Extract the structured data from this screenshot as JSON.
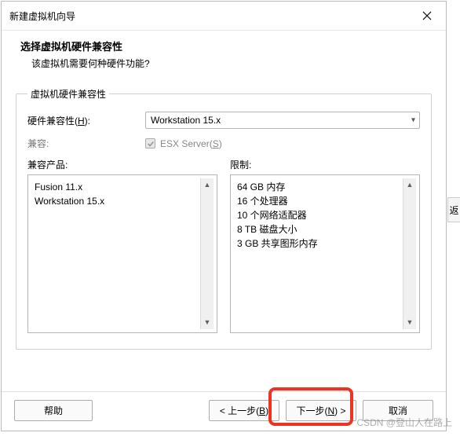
{
  "titlebar": {
    "title": "新建虚拟机向导"
  },
  "header": {
    "title": "选择虚拟机硬件兼容性",
    "subtitle": "该虚拟机需要何种硬件功能?"
  },
  "fieldset": {
    "legend": "虚拟机硬件兼容性",
    "compat_label_prefix": "硬件兼容性(",
    "compat_label_key": "H",
    "compat_label_suffix": "):",
    "compat_value": "Workstation 15.x",
    "compatible_label": "兼容:",
    "esx_prefix": "ESX Server(",
    "esx_key": "S",
    "esx_suffix": ")",
    "products_label": "兼容产品:",
    "limits_label": "限制:",
    "products": [
      "Fusion 11.x",
      "Workstation 15.x"
    ],
    "limits": [
      "64 GB 内存",
      "16 个处理器",
      "10 个网络适配器",
      "8 TB 磁盘大小",
      "3 GB 共享图形内存"
    ]
  },
  "footer": {
    "help": "帮助",
    "back_prefix": "< 上一步(",
    "back_key": "B",
    "back_suffix": ")",
    "next_prefix": "下一步(",
    "next_key": "N",
    "next_suffix": ") >",
    "cancel": "取消"
  },
  "annot": {
    "right": "返"
  },
  "watermark": "CSDN @登山人在路上"
}
